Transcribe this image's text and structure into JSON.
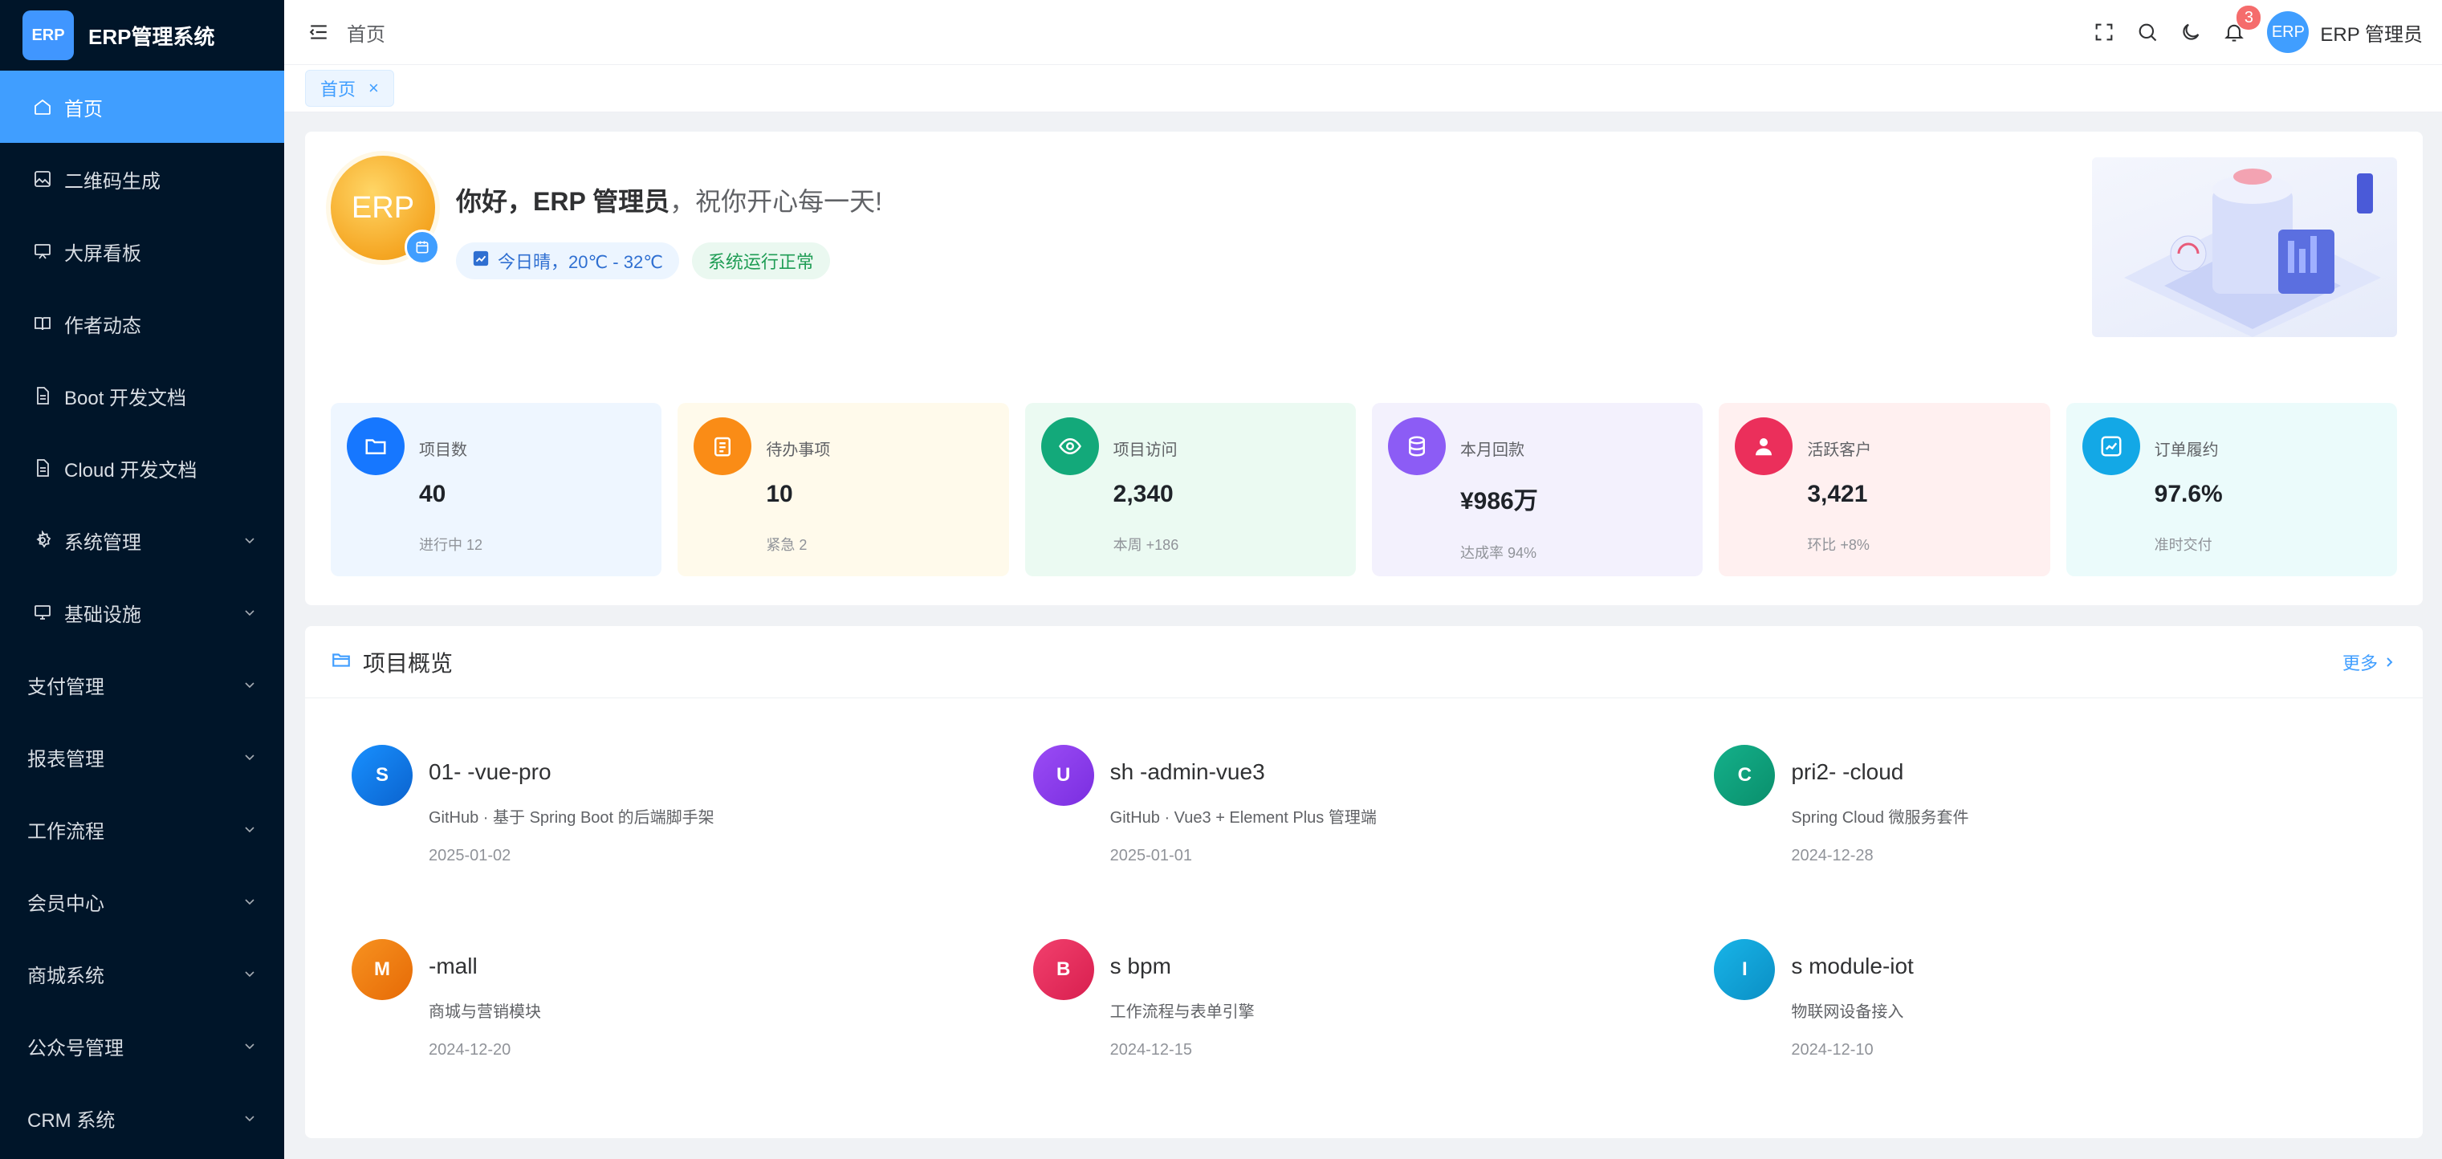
{
  "app": {
    "logo_badge": "ERP",
    "title": "ERP管理系统"
  },
  "sidebar": {
    "items": [
      {
        "label": "首页",
        "icon": "home-icon",
        "active": true
      },
      {
        "label": "二维码生成",
        "icon": "image-icon"
      },
      {
        "label": "大屏看板",
        "icon": "monitor-board-icon"
      },
      {
        "label": "作者动态",
        "icon": "book-icon"
      },
      {
        "label": "Boot 开发文档",
        "icon": "document-icon"
      },
      {
        "label": "Cloud 开发文档",
        "icon": "document-icon"
      },
      {
        "label": "系统管理",
        "icon": "gear-icon",
        "expandable": true
      },
      {
        "label": "基础设施",
        "icon": "monitor-icon",
        "expandable": true
      },
      {
        "label": "支付管理",
        "expandable": true
      },
      {
        "label": "报表管理",
        "expandable": true
      },
      {
        "label": "工作流程",
        "expandable": true
      },
      {
        "label": "会员中心",
        "expandable": true
      },
      {
        "label": "商城系统",
        "expandable": true
      },
      {
        "label": "公众号管理",
        "expandable": true
      },
      {
        "label": "CRM 系统",
        "expandable": true
      }
    ]
  },
  "header": {
    "breadcrumb": "首页",
    "notification_count": "3",
    "user_avatar": "ERP",
    "user_name": "ERP 管理员"
  },
  "tabs": [
    {
      "label": "首页",
      "close": "×"
    }
  ],
  "welcome": {
    "avatar_text": "ERP",
    "greeting_prefix": "你好，",
    "greeting_name": "ERP 管理员",
    "greeting_suffix": "，祝你开心每一天!",
    "weather": "今日晴，20℃ - 32℃",
    "status": "系统运行正常"
  },
  "stats": [
    {
      "label": "项目数",
      "value": "40",
      "sub": "进行中 12",
      "icon": "folder-icon",
      "color": "#1677ff",
      "bg": "#eef6ff"
    },
    {
      "label": "待办事项",
      "value": "10",
      "sub": "紧急 2",
      "icon": "clipboard-icon",
      "color": "#fa8c16",
      "bg": "#fffaeb"
    },
    {
      "label": "项目访问",
      "value": "2,340",
      "sub": "本周 +186",
      "icon": "eye-icon",
      "color": "#13a97a",
      "bg": "#ebfaf2"
    },
    {
      "label": "本月回款",
      "value": "¥986万",
      "sub": "达成率 94%",
      "icon": "database-icon",
      "color": "#8c5cf5",
      "bg": "#f3f1fd"
    },
    {
      "label": "活跃客户",
      "value": "3,421",
      "sub": "环比 +8%",
      "icon": "user-icon",
      "color": "#eb2f5b",
      "bg": "#fff0f0"
    },
    {
      "label": "订单履约",
      "value": "97.6%",
      "sub": "准时交付",
      "icon": "trend-chart-icon",
      "color": "#13a8e6",
      "bg": "#ebfbfb"
    }
  ],
  "projects_section": {
    "title": "项目概览",
    "more": "更多"
  },
  "projects": [
    {
      "letter": "S",
      "name": "01- -vue-pro",
      "desc": "GitHub · 基于 Spring Boot 的后端脚手架",
      "date": "2025-01-02",
      "color": "#1677ff"
    },
    {
      "letter": "U",
      "name": "sh -admin-vue3",
      "desc": "GitHub · Vue3 + Element Plus 管理端",
      "date": "2025-01-01",
      "color": "#8c3cf0"
    },
    {
      "letter": "C",
      "name": "pri2- -cloud",
      "desc": "Spring Cloud 微服务套件",
      "date": "2024-12-28",
      "color": "#10a37f"
    },
    {
      "letter": "M",
      "name": "-mall",
      "desc": "商城与营销模块",
      "date": "2024-12-20",
      "color": "#f07a10"
    },
    {
      "letter": "B",
      "name": "s bpm",
      "desc": "工作流程与表单引擎",
      "date": "2024-12-15",
      "color": "#e8305f"
    },
    {
      "letter": "I",
      "name": "s module-iot",
      "desc": "物联网设备接入",
      "date": "2024-12-10",
      "color": "#0ea5d8"
    }
  ]
}
